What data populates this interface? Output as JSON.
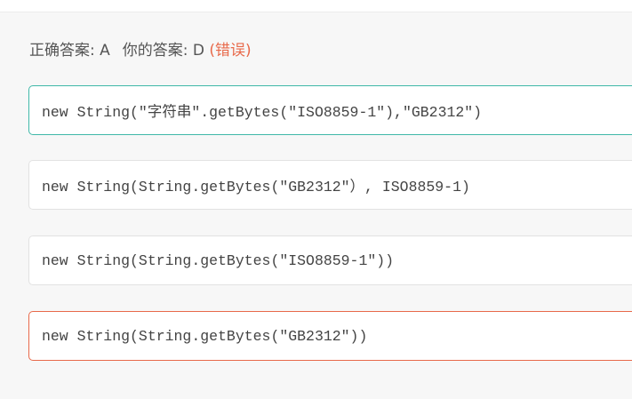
{
  "result": {
    "correct_label": "正确答案: A",
    "yours_label": "你的答案: D",
    "verdict": "(错误)"
  },
  "options": [
    {
      "text": "new String(\"字符串\".getBytes(\"ISO8859-1\"),\"GB2312\")",
      "state": "correct"
    },
    {
      "text": "new String(String.getBytes(\"GB2312\"）, ISO8859-1)",
      "state": "neutral"
    },
    {
      "text": "new String(String.getBytes(\"ISO8859-1\"))",
      "state": "neutral"
    },
    {
      "text": "new String(String.getBytes(\"GB2312\"))",
      "state": "selected-wrong"
    }
  ],
  "colors": {
    "correct_border": "#3fb8a8",
    "wrong": "#e8694a",
    "neutral_border": "#e2e2e2",
    "background": "#f7f7f7"
  }
}
